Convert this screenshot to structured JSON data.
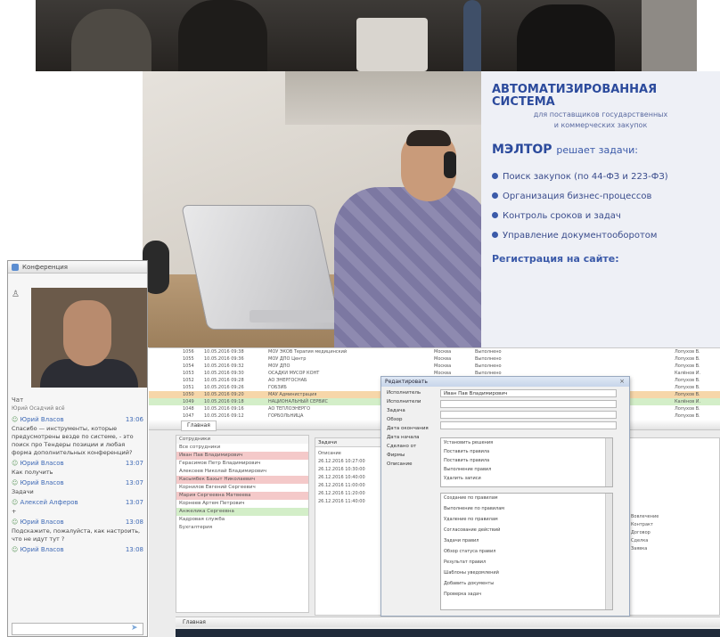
{
  "banner": {
    "heading": "АВТОМАТИЗИРОВАННАЯ СИСТЕМА",
    "subheading_1": "для поставщиков государственных",
    "subheading_2": "и коммерческих закупок",
    "brand": "МЭЛТОР",
    "brand_suffix": "решает задачи:",
    "items": [
      "Поиск закупок (по 44-ФЗ и 223-ФЗ)",
      "Организация бизнес-процессов",
      "Контроль сроков и задач",
      "Управление документооборотом"
    ],
    "registration": "Регистрация на сайте:"
  },
  "conference": {
    "title": "Конференция",
    "chat_label": "Чат",
    "chat_subheader": "Юрий Осадчий всё",
    "messages": [
      {
        "author": "Юрий Власов",
        "time": "13:06",
        "text": "Спасибо — инструменты, которые предусмотрены везде по системе, - это поиск про Тендеры позиции и любая форма дополнительных конференций?"
      },
      {
        "author": "Юрий Власов",
        "time": "13:07",
        "text": "Как получить"
      },
      {
        "author": "Юрий Власов",
        "time": "13:07",
        "text": "Задачи"
      },
      {
        "author": "Алексей Алферов",
        "time": "13:07",
        "text": "+"
      },
      {
        "author": "Юрий Власов",
        "time": "13:08",
        "text": "Подскажите, пожалуйста, как настроить, что не идут тут ?"
      },
      {
        "author": "Юрий Власов",
        "time": "13:08",
        "text": ""
      }
    ]
  },
  "app": {
    "grid_rows": [
      {
        "id": "1056",
        "date": "10.05.2016 09:38",
        "text": "МОУ ЭКОВ Терапия медицинский",
        "place": "Москва",
        "status": "Выполнено",
        "owner": "Лопухов В."
      },
      {
        "id": "1055",
        "date": "10.05.2016 09:36",
        "text": "МОУ ДПО Центр",
        "place": "Москва",
        "status": "Выполнено",
        "owner": "Лопухов В."
      },
      {
        "id": "1054",
        "date": "10.05.2016 09:32",
        "text": "МОУ ДПО",
        "place": "Москва",
        "status": "Выполнено",
        "owner": "Лопухов В."
      },
      {
        "id": "1053",
        "date": "10.05.2016 09:30",
        "text": "ОСАДКИ МУСОР КОНТ",
        "place": "Москва",
        "status": "Выполнено",
        "owner": "Калёнов И."
      },
      {
        "id": "1052",
        "date": "10.05.2016 09:28",
        "text": "АО ЭНЕРГОСНАБ",
        "place": "Москва",
        "status": "Выполнено",
        "owner": "Лопухов В."
      },
      {
        "id": "1051",
        "date": "10.05.2016 09:26",
        "text": "ГОБЗИБ",
        "place": "Москва",
        "status": "Выполнено",
        "owner": "Лопухов В."
      },
      {
        "id": "1050",
        "date": "10.05.2016 09:20",
        "text": "МАУ Администрация",
        "place": "Москва",
        "status": "Выполнено",
        "owner": "Лопухов В."
      },
      {
        "id": "1049",
        "date": "10.05.2016 09:18",
        "text": "НАЦИОНАЛЬНЫЙ СЕРВИС",
        "place": "Москва",
        "status": "Выполнено",
        "owner": "Калёнов И."
      },
      {
        "id": "1048",
        "date": "10.05.2016 09:16",
        "text": "АО ТЕПЛОЭНЕРГО",
        "place": "Москва",
        "status": "Выполнено",
        "owner": "Лопухов В."
      },
      {
        "id": "1047",
        "date": "10.05.2016 09:12",
        "text": "ГОРБОЛЬНИЦА",
        "place": "Москва",
        "status": "Выполнено",
        "owner": "Лопухов В."
      }
    ],
    "tab_label": "Главная",
    "left_rows": [
      "Сотрудники",
      "Все сотрудники",
      "Иван Пав Владимирович",
      "Герасимов Петр Владимирович",
      "Алексеев Николай Владимирович",
      "Касымбек Бахыт Николаевич",
      "Корнилов Евгений Сергеевич",
      "Мария Сергеевна Матвеева",
      "Корнеев Артем Петрович",
      "Анжелика Сергеевна",
      "Кадровая служба",
      "Бухгалтерия"
    ],
    "mid_header": "Задачи",
    "mid_rows": [
      "Описание",
      "26.12.2016 10:27:00",
      "26.12.2016 10:30:00",
      "26.12.2016 10:40:00",
      "26.12.2016 11:00:00",
      "26.12.2016 11:20:00",
      "26.12.2016 11:40:00"
    ],
    "dialog": {
      "title": "Редактировать",
      "close": "×",
      "labels": [
        "Исполнитель",
        "Исполнители",
        "Задача",
        "Обзор",
        "Дата окончания",
        "Дата начала",
        "Сделано от",
        "Фирмы",
        "Описание"
      ],
      "assignee": "Иван Пав Владимирович",
      "list_items": [
        "Установить решения",
        "Поставить правила",
        "Поставить правила",
        "Выполнение правил",
        "Удалить записи"
      ],
      "list2_items": [
        "Создание по правилам",
        "Выполнение по правилам",
        "Удаление по правилам",
        "Согласование действий",
        "Задачи правил",
        "Обзор статуса правил",
        "Результат правил",
        "Шаблоны уведомлений",
        "Добавить документы",
        "Проверка задач"
      ]
    },
    "right_rows": [
      "Вовлечение",
      "Контракт",
      "Договор",
      "Сделка",
      "Заявка"
    ],
    "bottom_bar": "Главная"
  },
  "colors": {
    "highlight_orange": "#f6d6a9",
    "highlight_green": "#d3eec8",
    "highlight_pink": "#f4c9c9",
    "brand_blue": "#2b4a9c"
  }
}
